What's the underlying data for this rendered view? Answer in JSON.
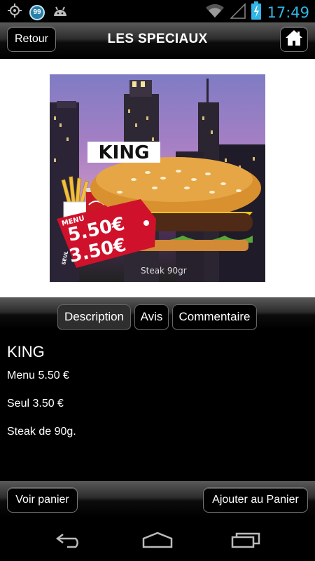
{
  "status_bar": {
    "clock": "17:49",
    "notification_count": "99",
    "icons": [
      "gps-icon",
      "notification-count-icon",
      "android-icon",
      "wifi-icon",
      "signal-icon",
      "battery-icon"
    ]
  },
  "header": {
    "back_label": "Retour",
    "title": "LES SPECIAUX",
    "home_icon": "home-icon"
  },
  "promo": {
    "product_label": "KING",
    "menu_tag": "MENU",
    "menu_price": "5.50€",
    "single_tag": "SEUL",
    "single_price": "3.50€",
    "caption": "Steak 90gr"
  },
  "tabs": [
    {
      "label": "Description",
      "active": true
    },
    {
      "label": "Avis",
      "active": false
    },
    {
      "label": "Commentaire",
      "active": false
    }
  ],
  "product": {
    "name": "KING",
    "lines": [
      "Menu 5.50 €",
      "Seul 3.50 €",
      "Steak de 90g."
    ]
  },
  "actions": {
    "cart_label": "Voir panier",
    "add_label": "Ajouter au Panier"
  },
  "navbar": {
    "icons": [
      "back-nav-icon",
      "home-nav-icon",
      "recent-apps-icon"
    ]
  },
  "colors": {
    "clock": "#33b5e5",
    "price_tag": "#d0112b",
    "background": "#000000"
  }
}
